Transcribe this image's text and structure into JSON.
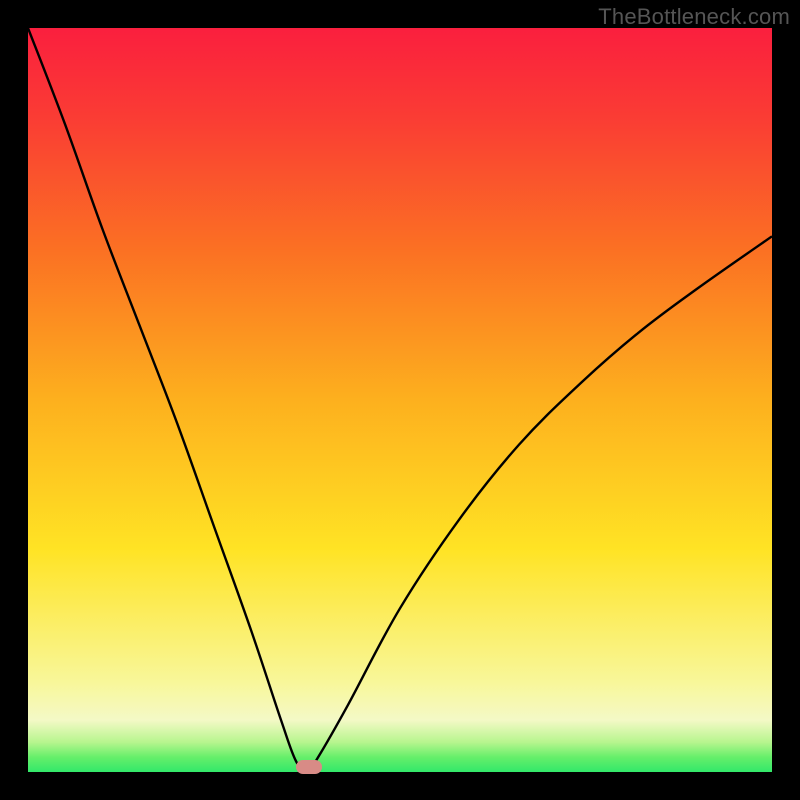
{
  "watermark": "TheBottleneck.com",
  "chart_data": {
    "type": "line",
    "title": "",
    "xlabel": "",
    "ylabel": "",
    "xlim": [
      0,
      1
    ],
    "ylim": [
      0,
      1
    ],
    "gradient_stops": [
      {
        "pos": 0.0,
        "color": "#32e86a"
      },
      {
        "pos": 0.02,
        "color": "#66ef6a"
      },
      {
        "pos": 0.04,
        "color": "#b7f58e"
      },
      {
        "pos": 0.07,
        "color": "#f4f9c6"
      },
      {
        "pos": 0.12,
        "color": "#f8f79a"
      },
      {
        "pos": 0.3,
        "color": "#ffe324"
      },
      {
        "pos": 0.5,
        "color": "#fdb01e"
      },
      {
        "pos": 0.7,
        "color": "#fb7123"
      },
      {
        "pos": 0.88,
        "color": "#fa3c34"
      },
      {
        "pos": 1.0,
        "color": "#fa1f3e"
      }
    ],
    "series": [
      {
        "name": "bottleneck-curve",
        "x": [
          0.0,
          0.05,
          0.1,
          0.15,
          0.2,
          0.25,
          0.3,
          0.34,
          0.36,
          0.375,
          0.39,
          0.43,
          0.5,
          0.58,
          0.66,
          0.74,
          0.82,
          0.9,
          1.0
        ],
        "values": [
          1.0,
          0.87,
          0.73,
          0.6,
          0.47,
          0.33,
          0.19,
          0.07,
          0.015,
          0.0,
          0.02,
          0.09,
          0.22,
          0.34,
          0.44,
          0.52,
          0.59,
          0.65,
          0.72
        ]
      }
    ],
    "marker": {
      "x": 0.378,
      "y": 0.007,
      "color": "#d88b86"
    }
  }
}
